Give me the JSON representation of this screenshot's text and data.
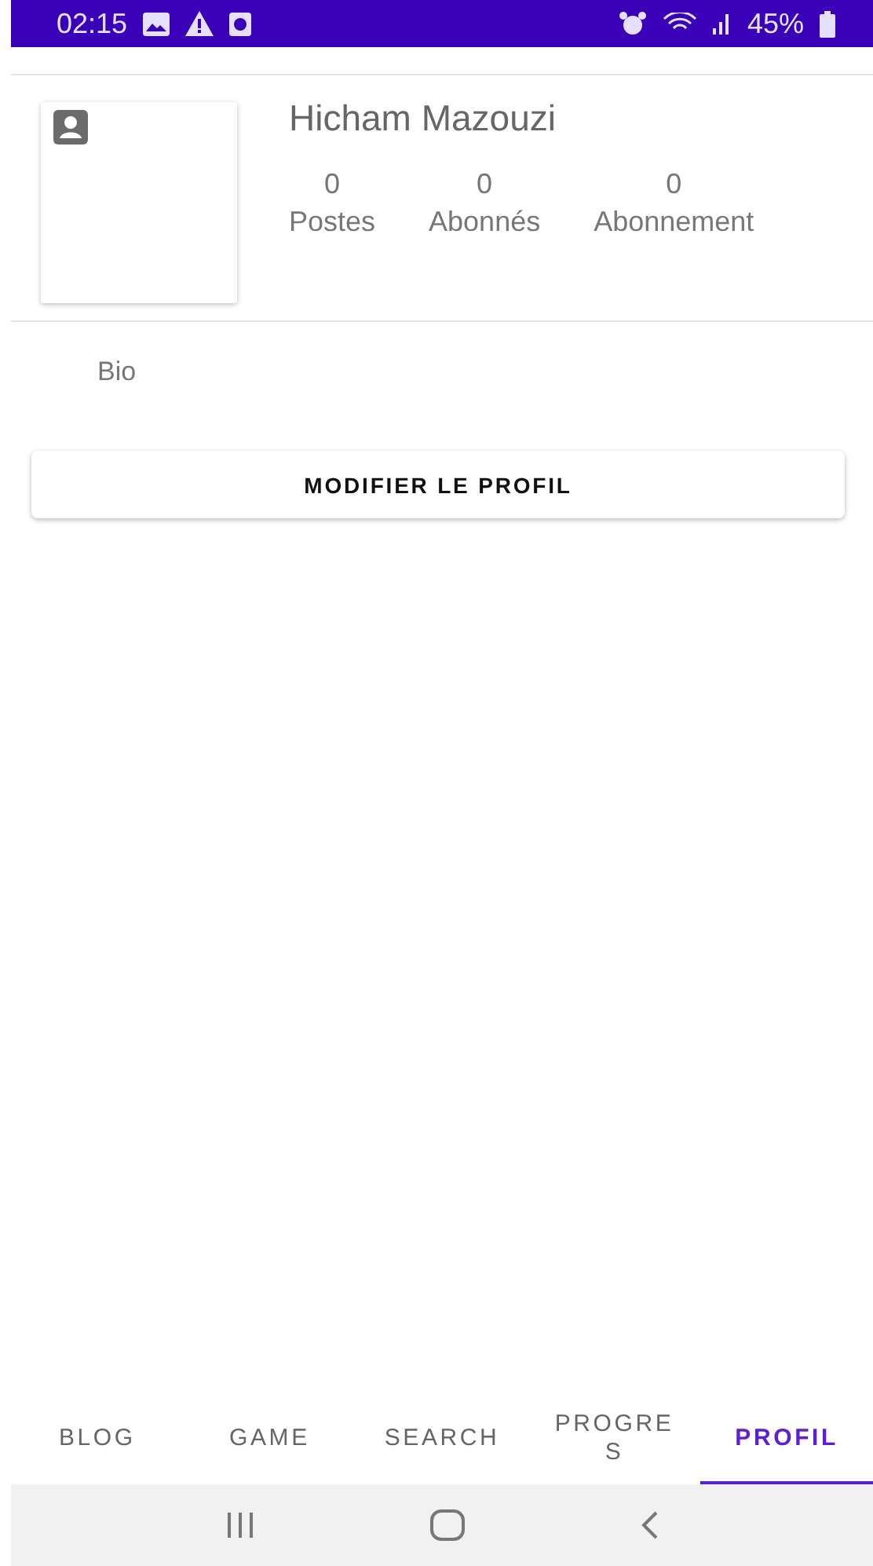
{
  "status_bar": {
    "time": "02:15",
    "battery": "45%"
  },
  "profile": {
    "name": "Hicham Mazouzi",
    "stats": [
      {
        "value": "0",
        "label": "Postes"
      },
      {
        "value": "0",
        "label": "Abonnés"
      },
      {
        "value": "0",
        "label": "Abonnement"
      }
    ],
    "bio": "Bio"
  },
  "edit_button": "MODIFIER LE PROFIL",
  "tabs": [
    {
      "label": "BLOG",
      "selected": false
    },
    {
      "label": "GAME",
      "selected": false
    },
    {
      "label": "SEARCH",
      "selected": false
    },
    {
      "label": "PROGRES",
      "selected": false
    },
    {
      "label": "PROFIL",
      "selected": true
    }
  ]
}
